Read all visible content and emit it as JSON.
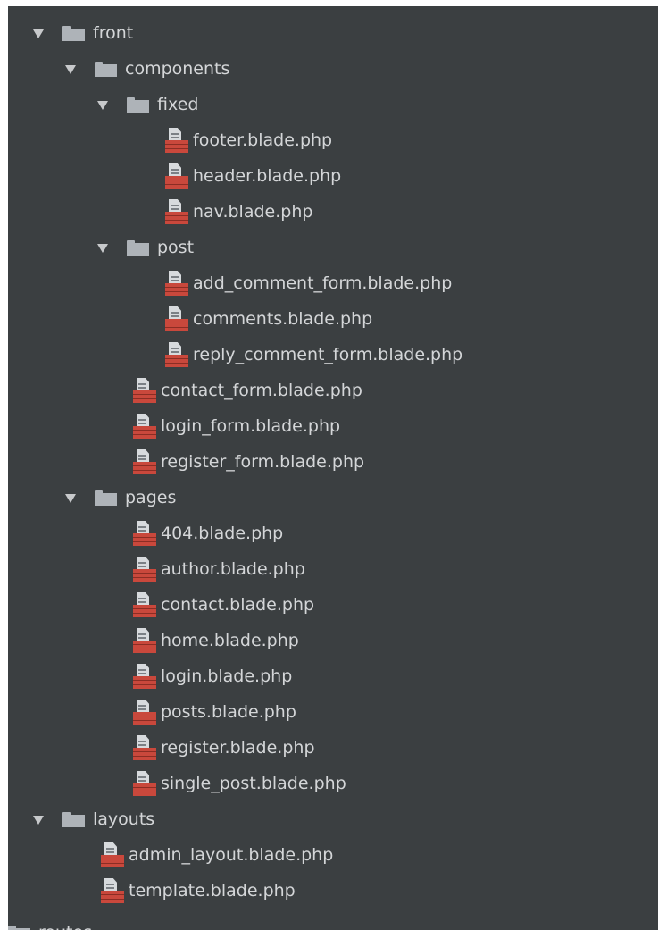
{
  "tree": {
    "rows": [
      {
        "type": "folder",
        "label": "front",
        "level": 0
      },
      {
        "type": "folder",
        "label": "components",
        "level": 1
      },
      {
        "type": "folder",
        "label": "fixed",
        "level": 2
      },
      {
        "type": "file",
        "label": "footer.blade.php",
        "level": 3
      },
      {
        "type": "file",
        "label": "header.blade.php",
        "level": 3
      },
      {
        "type": "file",
        "label": "nav.blade.php",
        "level": 3
      },
      {
        "type": "folder",
        "label": "post",
        "level": 2
      },
      {
        "type": "file",
        "label": "add_comment_form.blade.php",
        "level": 3
      },
      {
        "type": "file",
        "label": "comments.blade.php",
        "level": 3
      },
      {
        "type": "file",
        "label": "reply_comment_form.blade.php",
        "level": 3
      },
      {
        "type": "file",
        "label": "contact_form.blade.php",
        "level": 2
      },
      {
        "type": "file",
        "label": "login_form.blade.php",
        "level": 2
      },
      {
        "type": "file",
        "label": "register_form.blade.php",
        "level": 2
      },
      {
        "type": "folder",
        "label": "pages",
        "level": 1
      },
      {
        "type": "file",
        "label": "404.blade.php",
        "level": 2
      },
      {
        "type": "file",
        "label": "author.blade.php",
        "level": 2
      },
      {
        "type": "file",
        "label": "contact.blade.php",
        "level": 2
      },
      {
        "type": "file",
        "label": "home.blade.php",
        "level": 2
      },
      {
        "type": "file",
        "label": "login.blade.php",
        "level": 2
      },
      {
        "type": "file",
        "label": "posts.blade.php",
        "level": 2
      },
      {
        "type": "file",
        "label": "register.blade.php",
        "level": 2
      },
      {
        "type": "file",
        "label": "single_post.blade.php",
        "level": 2
      },
      {
        "type": "folder",
        "label": "layouts",
        "level": 0
      },
      {
        "type": "file",
        "label": "admin_layout.blade.php",
        "level": 1
      },
      {
        "type": "file",
        "label": "template.blade.php",
        "level": 1
      }
    ],
    "bottom_cut_label": "routes"
  },
  "colors": {
    "background": "#3b3f41",
    "text": "#d4d6d8",
    "folder": "#aeb3b8",
    "blade_icon": "#c9483c"
  },
  "icons": {
    "folder": "folder-icon",
    "file": "blade-file-icon",
    "expanded": "expand-arrow-icon"
  }
}
